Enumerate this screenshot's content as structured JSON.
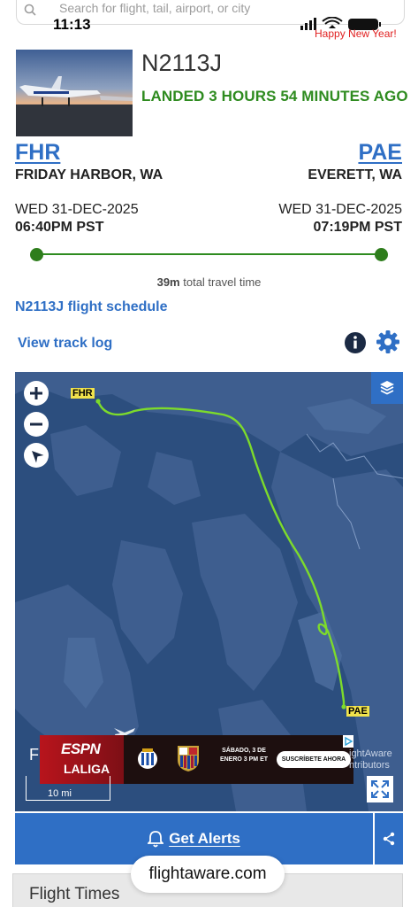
{
  "status_bar": {
    "time": "11:13",
    "banner": "Happy New Year!"
  },
  "search": {
    "placeholder": "Search for flight, tail, airport, or city"
  },
  "flight": {
    "tail_number": "N2113J",
    "status": "LANDED 3 HOURS 54 MINUTES AGO",
    "origin": {
      "code": "FHR",
      "city": "FRIDAY HARBOR, WA",
      "date": "WED 31-DEC-2025",
      "time": "06:40PM PST"
    },
    "destination": {
      "code": "PAE",
      "city": "EVERETT, WA",
      "date": "WED 31-DEC-2025",
      "time": "07:19PM PST"
    },
    "travel_duration": "39m",
    "travel_suffix": "total travel time",
    "progress": 1.0
  },
  "links": {
    "schedule": "N2113J flight schedule",
    "track_log": "View track log"
  },
  "map": {
    "origin_label": "FHR",
    "destination_label": "PAE",
    "scale": "10 mi",
    "attribution_line1": "ightAware",
    "attribution_line2": "ntributors",
    "route_color": "#7ddb2b",
    "water_color": "#2c4e7e"
  },
  "ad": {
    "brand": "ESPN",
    "league": "LALIGA",
    "date_text": "SÁBADO, 3 DE ENERO 3 PM ET",
    "cta": "SUSCRÍBETE AHORA"
  },
  "bottom": {
    "alerts": "Get Alerts",
    "section_title": "Flight Times",
    "url": "flightaware.com"
  },
  "colors": {
    "accent": "#2f6fc5",
    "landed": "#2e8b1f",
    "route": "#2e8b1f"
  },
  "icons": [
    "search-icon",
    "wifi-icon",
    "signal-icon",
    "battery-icon",
    "info-icon",
    "gear-icon",
    "zoom-in-icon",
    "zoom-out-icon",
    "compass-icon",
    "layers-icon",
    "fullscreen-icon",
    "bell-icon",
    "share-icon"
  ]
}
